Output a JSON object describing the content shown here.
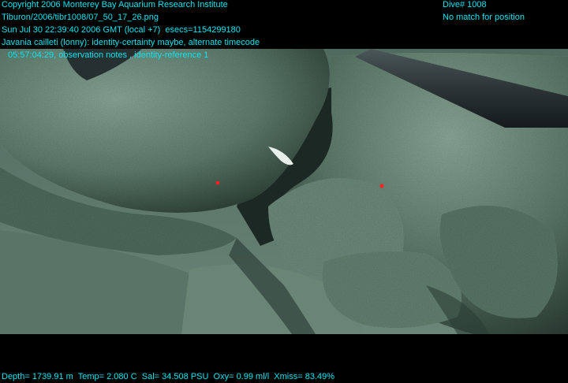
{
  "overlay": {
    "copyright": "Copyright 2006 Monterey Bay Aquarium Research Institute",
    "file_path": "Tiburon/2006/tibr1008/07_50_17_26.png",
    "datetime": "Sun Jul 30 22:39:40 2006 GMT (local +7)  esecs=1154299180",
    "annotation": "Javania cailleti (lonny): identity-certainty maybe, alternate timecode",
    "annotation_detail": "05:57:04:29, observation notes , identity-reference 1",
    "dive": "Dive# 1008",
    "position_status": "No match for position",
    "telemetry": "Depth= 1739.91 m  Temp= 2.080 C  Sal= 34.508 PSU  Oxy= 0.99 ml/l  Xmiss= 83.49%"
  },
  "colors": {
    "overlay_text": "#00e8f0",
    "rock": "#5f7e70",
    "sediment": "#6e8a7c",
    "background": "#000000"
  }
}
